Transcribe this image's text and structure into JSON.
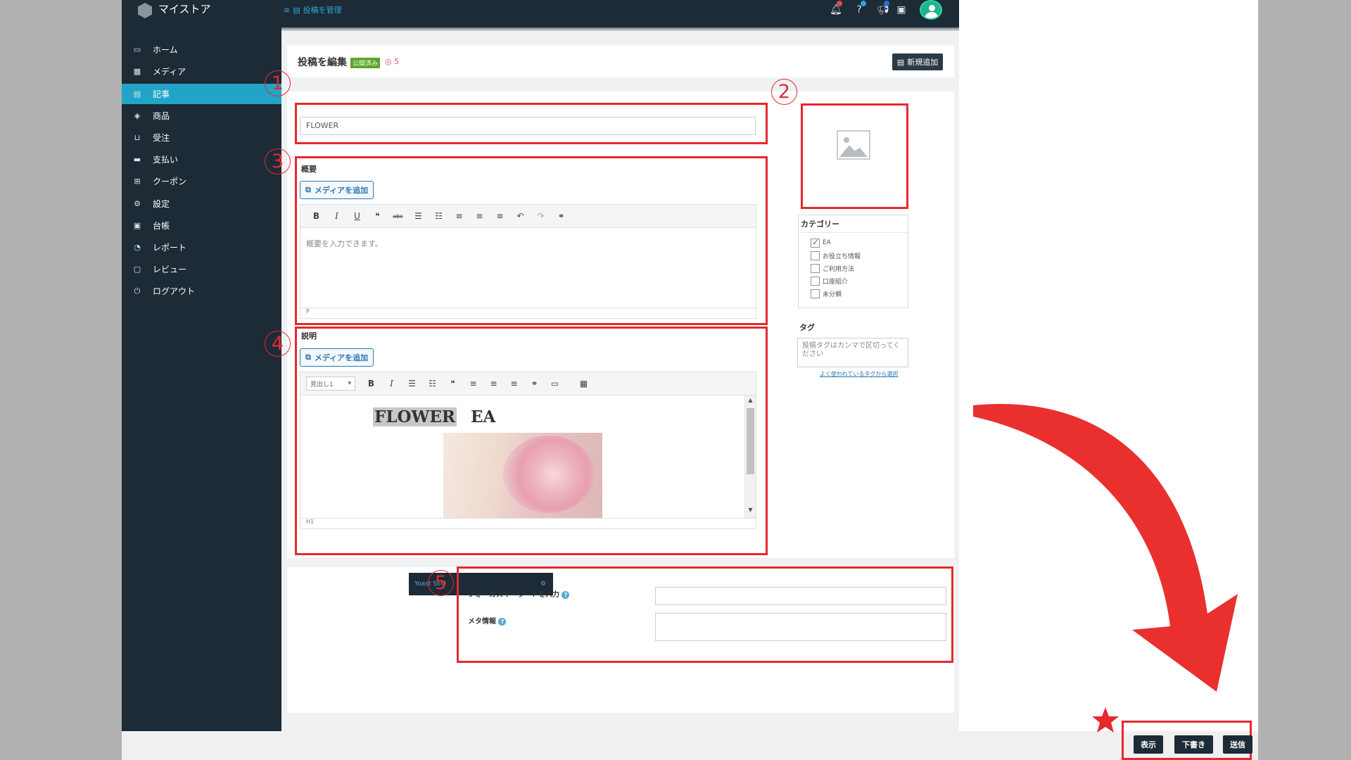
{
  "app": {
    "brand": "マイストア"
  },
  "breadcrumb": {
    "label": "投稿を管理"
  },
  "sidebar": {
    "items": [
      {
        "label": "ホーム"
      },
      {
        "label": "メディア"
      },
      {
        "label": "記事"
      },
      {
        "label": "商品"
      },
      {
        "label": "受注"
      },
      {
        "label": "支払い"
      },
      {
        "label": "クーポン"
      },
      {
        "label": "設定"
      },
      {
        "label": "台帳"
      },
      {
        "label": "レポート"
      },
      {
        "label": "レビュー"
      },
      {
        "label": "ログアウト"
      }
    ],
    "active_index": 2
  },
  "header": {
    "title": "投稿を編集",
    "status": "公開済み",
    "views": "5",
    "new_button": "新規追加"
  },
  "post": {
    "title_value": "FLOWER"
  },
  "summary": {
    "label": "概要",
    "media_button": "メディアを追加",
    "placeholder": "概要を入力できます。",
    "status_path": "P"
  },
  "description": {
    "label": "説明",
    "media_button": "メディアを追加",
    "format_select": "見出し1",
    "heading_text": "FLOWER",
    "heading_text_2": "EA",
    "status_path": "H1"
  },
  "category": {
    "title": "カテゴリー",
    "items": [
      {
        "label": "EA",
        "checked": true
      },
      {
        "label": "お役立ち情報",
        "checked": false
      },
      {
        "label": "ご利用方法",
        "checked": false
      },
      {
        "label": "口座紹介",
        "checked": false
      },
      {
        "label": "未分類",
        "checked": false
      }
    ]
  },
  "tags": {
    "title": "タグ",
    "placeholder": "投稿タグはカンマで区切ってください",
    "popular_link": "よく使われているタグから選択"
  },
  "seo": {
    "tab_label": "Yoast SEO",
    "focus_label": "フォーカスキーワードを入力",
    "meta_label": "メタ情報"
  },
  "annotations": {
    "n1": "1",
    "n2": "2",
    "n3": "3",
    "n4": "4",
    "n5": "5"
  },
  "actions": {
    "preview": "表示",
    "draft": "下書き",
    "submit": "送信"
  },
  "colors": {
    "topbar": "#1c2b36",
    "accent": "#21a4c7",
    "annotation_red": "#e5292f"
  }
}
